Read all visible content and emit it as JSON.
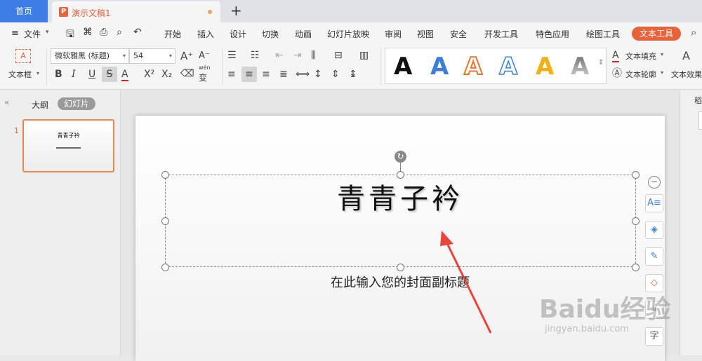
{
  "tabs": {
    "home": "首页",
    "document": "演示文稿1",
    "ppt_badge": "P"
  },
  "menu": {
    "file": "文件",
    "items": [
      "开始",
      "插入",
      "设计",
      "切换",
      "动画",
      "幻灯片放映",
      "审阅",
      "视图",
      "安全",
      "开发工具",
      "特色应用",
      "绘图工具"
    ],
    "active_tab": "文本工具"
  },
  "ribbon": {
    "textbox_label": "文本框",
    "font_name": "微软雅黑 (标题)",
    "font_size": "54",
    "text_fill": "文本填充",
    "text_outline": "文本轮廓",
    "text_effect": "文本效果",
    "style_letter": "A",
    "wen_label": "wén",
    "wen_char": "变"
  },
  "left_pane": {
    "outline_tab": "大纲",
    "slides_tab": "幻灯片",
    "slide_number": "1",
    "thumb_title": "青青子衿"
  },
  "slide": {
    "title": "青青子衿",
    "subtitle": "在此输入您的封面副标题"
  },
  "right_pane": {
    "label": "稻"
  },
  "watermark": {
    "brand": "Baidu经验",
    "url": "jingyan.baidu.com"
  },
  "colors": {
    "accent": "#e8623a",
    "tab_blue": "#3d7ee6",
    "arrow": "#e8463a"
  }
}
